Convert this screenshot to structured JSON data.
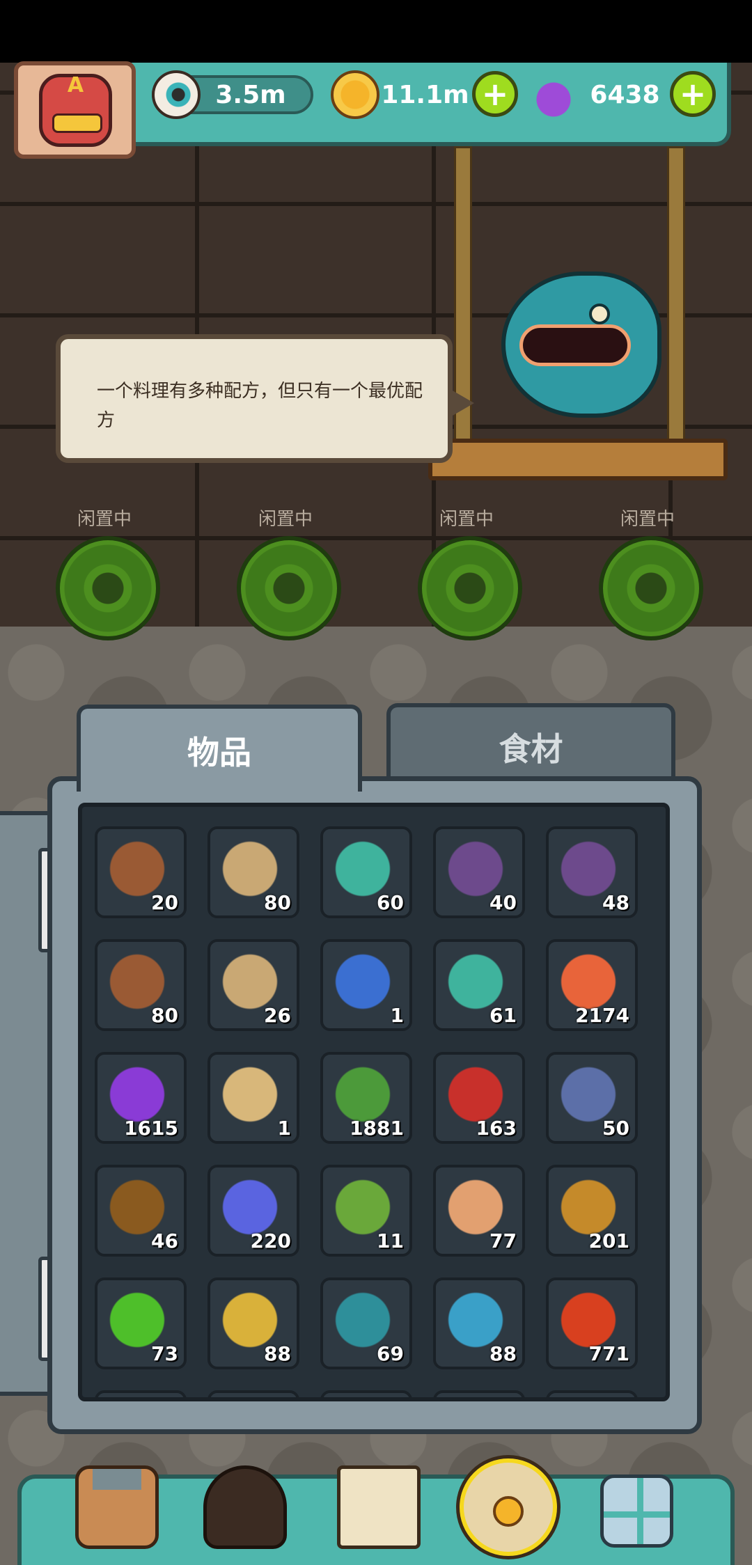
{
  "resources": {
    "eyeball": "3.5m",
    "coins": "11.1m",
    "potion": "6438",
    "plus": "+"
  },
  "avatar": {
    "letter": "A"
  },
  "speech": {
    "text": "一个料理有多种配方，但只有一个最优配方"
  },
  "idle_slots": [
    {
      "label": "闲置中"
    },
    {
      "label": "闲置中"
    },
    {
      "label": "闲置中"
    },
    {
      "label": "闲置中"
    }
  ],
  "tabs": [
    {
      "label": "物品",
      "active": true
    },
    {
      "label": "食材",
      "active": false
    }
  ],
  "items": [
    {
      "icon": "leather-scroll-icon",
      "color": "#9a5a34",
      "count": "20"
    },
    {
      "icon": "parchment-map-icon",
      "color": "#c9a874",
      "count": "80"
    },
    {
      "icon": "message-bottle-icon",
      "color": "#3fb39d",
      "count": "60"
    },
    {
      "icon": "monster-chest-icon",
      "color": "#6d4a8c",
      "count": "40"
    },
    {
      "icon": "monster-chest-icon",
      "color": "#6d4a8c",
      "count": "48"
    },
    {
      "icon": "leather-scroll-icon",
      "color": "#9a5a34",
      "count": "80"
    },
    {
      "icon": "parchment-map-icon",
      "color": "#c9a874",
      "count": "26"
    },
    {
      "icon": "blue-potion-bottle-icon",
      "color": "#3b6fd1",
      "count": "1"
    },
    {
      "icon": "message-bottle-icon",
      "color": "#3fb39d",
      "count": "61"
    },
    {
      "icon": "capsule-pill-icon",
      "color": "#e8643a",
      "count": "2174"
    },
    {
      "icon": "purple-powder-icon",
      "color": "#8a3bd6",
      "count": "1615"
    },
    {
      "icon": "torn-parchment-icon",
      "color": "#d8b77a",
      "count": "1"
    },
    {
      "icon": "photo-card-icon",
      "color": "#4c9a3a",
      "count": "1881"
    },
    {
      "icon": "oil-barrel-icon",
      "color": "#c8302b",
      "count": "163"
    },
    {
      "icon": "machine-card-icon",
      "color": "#5c6fa8",
      "count": "50"
    },
    {
      "icon": "cauldron-card-icon",
      "color": "#8a5a1f",
      "count": "46"
    },
    {
      "icon": "crystal-cluster-icon",
      "color": "#5a64e0",
      "count": "220"
    },
    {
      "icon": "green-ore-rock-icon",
      "color": "#6aa83a",
      "count": "11"
    },
    {
      "icon": "recipe-scroll-icon",
      "color": "#e2a070",
      "count": "77"
    },
    {
      "icon": "treasure-pile-icon",
      "color": "#c58a2a",
      "count": "201"
    },
    {
      "icon": "four-leaf-clover-icon",
      "color": "#4ebf2a",
      "count": "73"
    },
    {
      "icon": "gold-coin-stack-icon",
      "color": "#d9b13a",
      "count": "88"
    },
    {
      "icon": "gear-badge-icon",
      "color": "#2e8f9a",
      "count": "69"
    },
    {
      "icon": "blue-slime-puzzle-icon",
      "color": "#3aa0c8",
      "count": "88"
    },
    {
      "icon": "red-gem-triangle-icon",
      "color": "#d8401f",
      "count": "771"
    }
  ],
  "nav": [
    {
      "icon": "shop-building-icon"
    },
    {
      "icon": "monster-cave-icon"
    },
    {
      "icon": "recipe-book-icon"
    },
    {
      "icon": "coin-bag-icon",
      "selected": true
    },
    {
      "icon": "grid-menu-icon"
    }
  ]
}
